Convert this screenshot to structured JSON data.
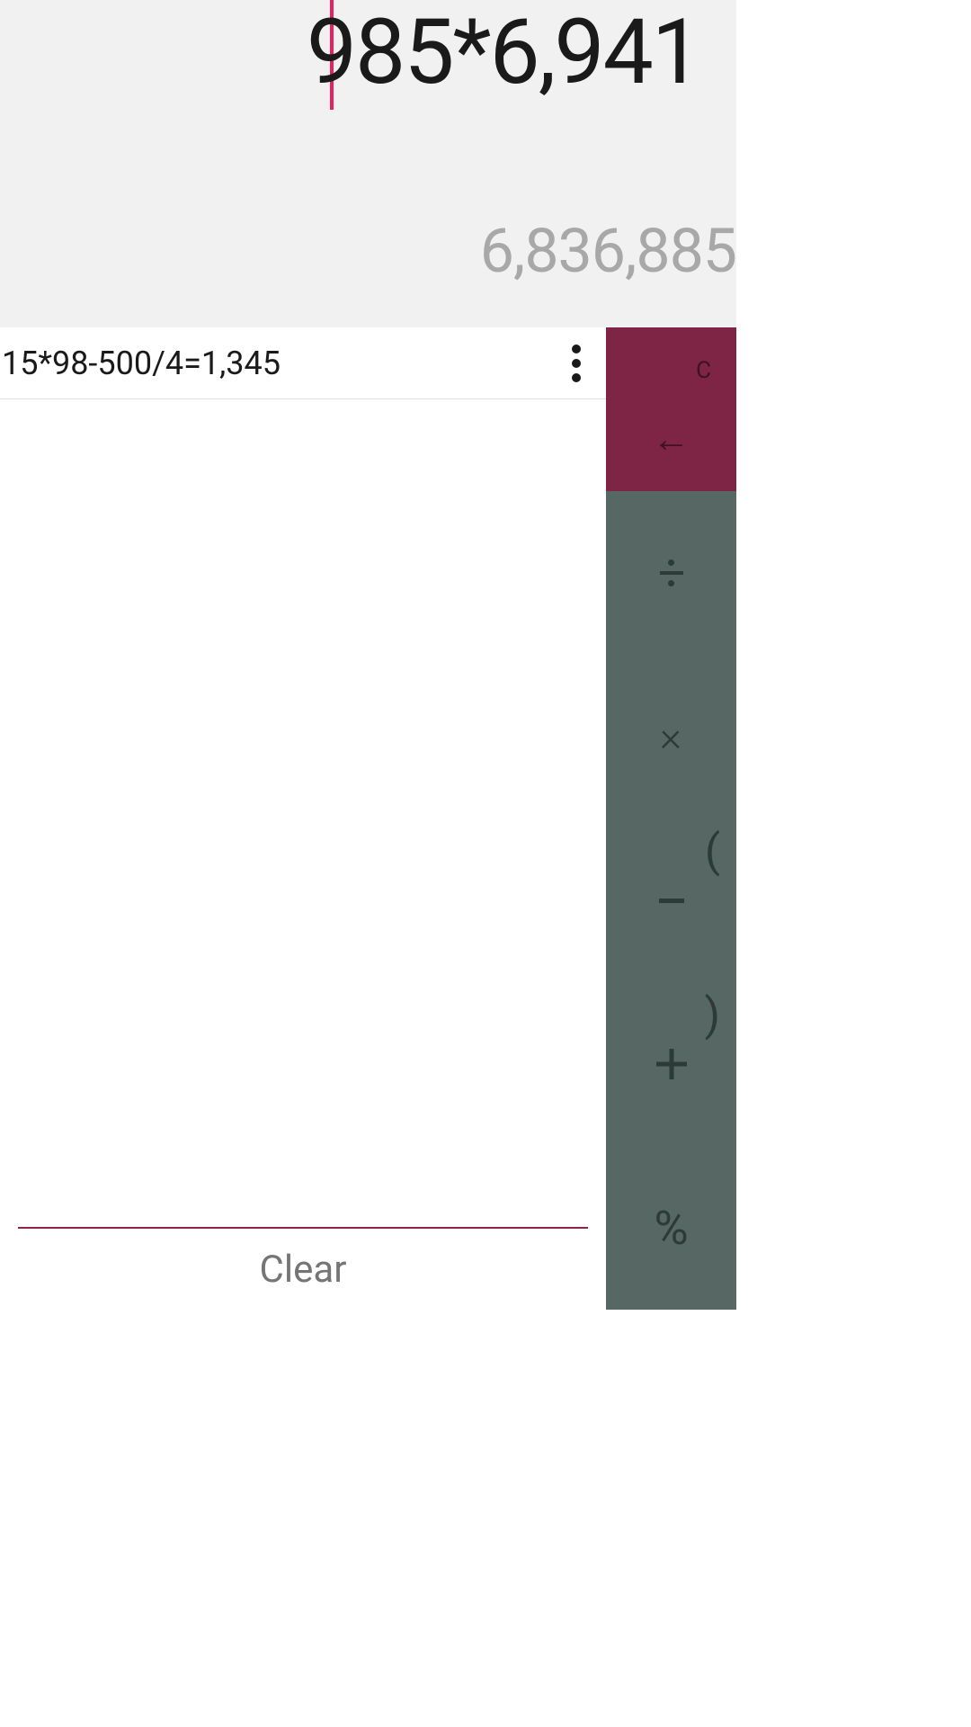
{
  "display": {
    "expression": "985*6,941",
    "result": "6,836,885"
  },
  "history": {
    "items": [
      {
        "text": "15*98-500/4=1,345"
      }
    ]
  },
  "controls": {
    "clear_char": "C",
    "clear_label": "Clear"
  },
  "operators": {
    "divide": "÷",
    "multiply": "×",
    "minus": "−",
    "plus": "+",
    "percent": "%",
    "paren_open": "(",
    "paren_close": ")"
  },
  "colors": {
    "display_bg": "#f1f1f2",
    "accent": "#e91e63",
    "top_panel": "#7e2546",
    "operator_panel": "#576764",
    "divider": "#8e2449"
  }
}
